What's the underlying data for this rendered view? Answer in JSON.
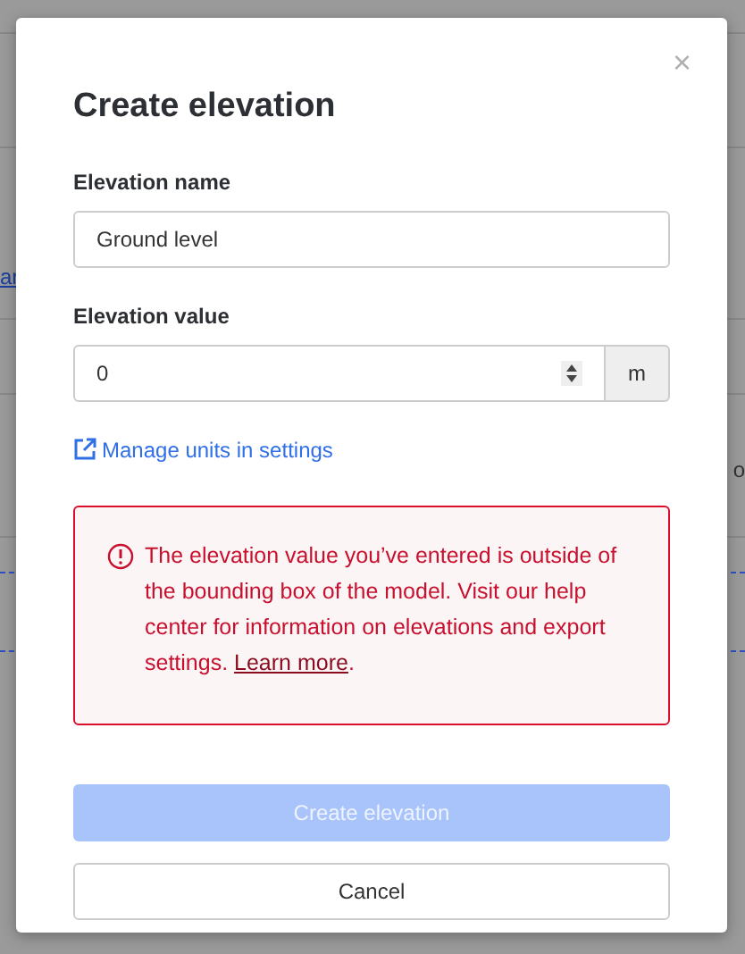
{
  "background": {
    "link_fragment": "ar",
    "text_fragment": "o"
  },
  "dialog": {
    "title": "Create elevation",
    "close": "×",
    "fields": [
      {
        "kind": "text",
        "label": "Elevation name",
        "value": "Ground level"
      },
      {
        "kind": "number",
        "label": "Elevation value",
        "value": "0",
        "unit": "m"
      }
    ],
    "settings_link": "Manage units in settings",
    "alert": {
      "text": "The elevation value you’ve entered is outside of the bounding box of the model. Visit our help center for information on elevations and export settings. ",
      "link": "Learn more",
      "after": "."
    },
    "buttons": [
      {
        "kind": "primary",
        "label": "Create elevation",
        "disabled": true
      },
      {
        "kind": "secondary",
        "label": "Cancel",
        "disabled": false
      }
    ]
  }
}
